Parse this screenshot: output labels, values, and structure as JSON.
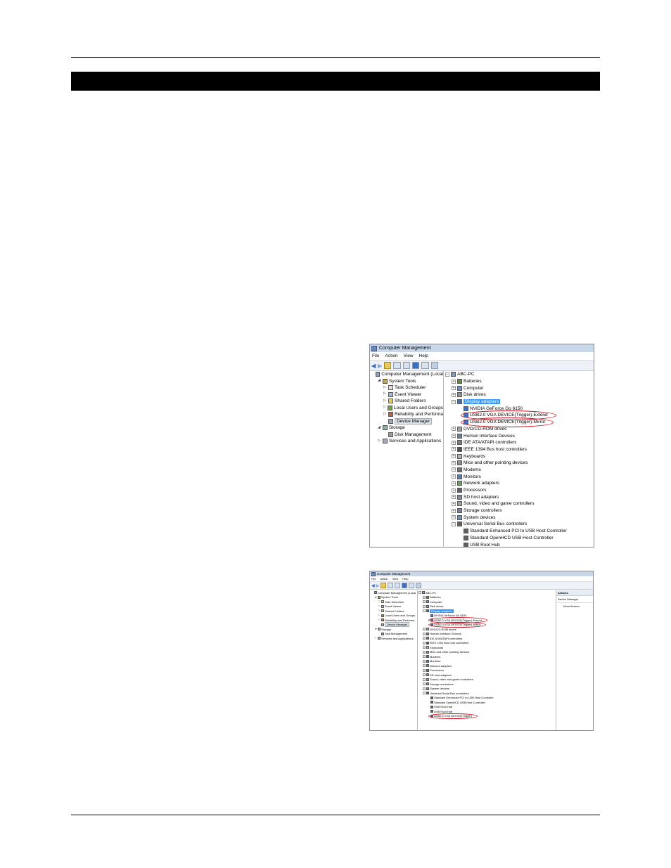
{
  "win1": {
    "title": "Computer Management",
    "menu": [
      "File",
      "Action",
      "View",
      "Help"
    ],
    "left_tree": [
      {
        "label": "Computer Management (Local",
        "level": 0,
        "exp": "none",
        "icon": "computer-management-icon",
        "color": "#8aa0c0"
      },
      {
        "label": "System Tools",
        "level": 1,
        "exp": "open",
        "icon": "tools-icon",
        "color": "#c9a04a"
      },
      {
        "label": "Task Scheduler",
        "level": 2,
        "exp": "closed",
        "icon": "clock-icon",
        "color": "#e8e0c8"
      },
      {
        "label": "Event Viewer",
        "level": 2,
        "exp": "closed",
        "icon": "event-viewer-icon",
        "color": "#9fb6d8"
      },
      {
        "label": "Shared Folders",
        "level": 2,
        "exp": "closed",
        "icon": "folder-icon",
        "color": "#e8c860"
      },
      {
        "label": "Local Users and Groups",
        "level": 2,
        "exp": "closed",
        "icon": "users-icon",
        "color": "#7a9a5a"
      },
      {
        "label": "Reliability and Performa",
        "level": 2,
        "exp": "closed",
        "icon": "gauge-icon",
        "color": "#c06040"
      },
      {
        "label": "Device Manager",
        "level": 2,
        "exp": "none",
        "icon": "device-manager-icon",
        "color": "#a0a8b8",
        "selected": true
      },
      {
        "label": "Storage",
        "level": 1,
        "exp": "open",
        "icon": "storage-icon",
        "color": "#8ab0a0"
      },
      {
        "label": "Disk Management",
        "level": 2,
        "exp": "none",
        "icon": "disk-icon",
        "color": "#9a9a9a"
      },
      {
        "label": "Services and Applications",
        "level": 1,
        "exp": "closed",
        "icon": "services-icon",
        "color": "#b0a0c0"
      }
    ],
    "right_tree": [
      {
        "label": "ABC-PC",
        "level": 0,
        "exp": "minus",
        "icon": "computer-icon",
        "color": "#8a9ab0"
      },
      {
        "label": "Batteries",
        "level": 1,
        "exp": "plus",
        "icon": "battery-icon",
        "color": "#6a8a4a"
      },
      {
        "label": "Computer",
        "level": 1,
        "exp": "plus",
        "icon": "computer-icon",
        "color": "#7090c0"
      },
      {
        "label": "Disk drives",
        "level": 1,
        "exp": "plus",
        "icon": "disk-drive-icon",
        "color": "#909090"
      },
      {
        "label": "Display adapters",
        "level": 1,
        "exp": "minus",
        "icon": "display-adapter-icon",
        "color": "#4070c0",
        "selected": true
      },
      {
        "label": "NVIDIA GeForce Go 6150",
        "level": 2,
        "exp": "none",
        "icon": "display-adapter-icon",
        "color": "#4070c0"
      },
      {
        "label": "USB2.0 VGA DEVICE(Trigger)-Extend",
        "level": 2,
        "exp": "none",
        "icon": "display-adapter-icon",
        "color": "#4070c0",
        "circled": true
      },
      {
        "label": "USB2.0 VGA DEVICE(Trigger)-Mirror",
        "level": 2,
        "exp": "none",
        "icon": "display-adapter-icon",
        "color": "#4070c0",
        "circled": true
      },
      {
        "label": "DVD/CD-ROM drives",
        "level": 1,
        "exp": "plus",
        "icon": "dvd-icon",
        "color": "#a0a0a0"
      },
      {
        "label": "Human Interface Devices",
        "level": 1,
        "exp": "plus",
        "icon": "hid-icon",
        "color": "#708090"
      },
      {
        "label": "IDE ATA/ATAPI controllers",
        "level": 1,
        "exp": "plus",
        "icon": "ide-icon",
        "color": "#808080"
      },
      {
        "label": "IEEE 1394 Bus host controllers",
        "level": 1,
        "exp": "plus",
        "icon": "firewire-icon",
        "color": "#505050"
      },
      {
        "label": "Keyboards",
        "level": 1,
        "exp": "plus",
        "icon": "keyboard-icon",
        "color": "#b0b0b0"
      },
      {
        "label": "Mice and other pointing devices",
        "level": 1,
        "exp": "plus",
        "icon": "mouse-icon",
        "color": "#909090"
      },
      {
        "label": "Modems",
        "level": 1,
        "exp": "plus",
        "icon": "modem-icon",
        "color": "#707070"
      },
      {
        "label": "Monitors",
        "level": 1,
        "exp": "plus",
        "icon": "monitor-icon",
        "color": "#5080b0"
      },
      {
        "label": "Network adapters",
        "level": 1,
        "exp": "plus",
        "icon": "network-icon",
        "color": "#60a060"
      },
      {
        "label": "Processors",
        "level": 1,
        "exp": "plus",
        "icon": "processor-icon",
        "color": "#606060"
      },
      {
        "label": "SD host adapters",
        "level": 1,
        "exp": "plus",
        "icon": "sd-card-icon",
        "color": "#8090a0"
      },
      {
        "label": "Sound, video and game controllers",
        "level": 1,
        "exp": "plus",
        "icon": "speaker-icon",
        "color": "#a0a0a0"
      },
      {
        "label": "Storage controllers",
        "level": 1,
        "exp": "plus",
        "icon": "storage-controller-icon",
        "color": "#8080a0"
      },
      {
        "label": "System devices",
        "level": 1,
        "exp": "plus",
        "icon": "system-device-icon",
        "color": "#7090b0"
      },
      {
        "label": "Universal Serial Bus controllers",
        "level": 1,
        "exp": "minus",
        "icon": "usb-icon",
        "color": "#606060"
      },
      {
        "label": "Standard Enhanced PCI to USB Host Controller",
        "level": 2,
        "exp": "none",
        "icon": "usb-icon",
        "color": "#606060"
      },
      {
        "label": "Standard OpenHCD USB Host Controller",
        "level": 2,
        "exp": "none",
        "icon": "usb-icon",
        "color": "#606060"
      },
      {
        "label": "USB Root Hub",
        "level": 2,
        "exp": "none",
        "icon": "usb-icon",
        "color": "#606060"
      }
    ]
  },
  "win2": {
    "title": "Computer Management",
    "menu": [
      "File",
      "Action",
      "View",
      "Help"
    ],
    "actions_header": "Actions",
    "actions_section": "Device Manager",
    "actions_more": "More Actions",
    "left_tree": [
      {
        "label": "Computer Management (Local",
        "level": 0,
        "exp": "none",
        "icon": "computer-management-icon",
        "color": "#8aa0c0"
      },
      {
        "label": "System Tools",
        "level": 1,
        "exp": "open",
        "icon": "tools-icon",
        "color": "#c9a04a"
      },
      {
        "label": "Task Scheduler",
        "level": 2,
        "exp": "closed",
        "icon": "clock-icon",
        "color": "#e8e0c8"
      },
      {
        "label": "Event Viewer",
        "level": 2,
        "exp": "closed",
        "icon": "event-viewer-icon",
        "color": "#9fb6d8"
      },
      {
        "label": "Shared Folders",
        "level": 2,
        "exp": "closed",
        "icon": "folder-icon",
        "color": "#e8c860"
      },
      {
        "label": "Local Users and Groups",
        "level": 2,
        "exp": "closed",
        "icon": "users-icon",
        "color": "#7a9a5a"
      },
      {
        "label": "Reliability and Performa",
        "level": 2,
        "exp": "closed",
        "icon": "gauge-icon",
        "color": "#c06040"
      },
      {
        "label": "Device Manager",
        "level": 2,
        "exp": "none",
        "icon": "device-manager-icon",
        "color": "#a0a8b8",
        "selected": true
      },
      {
        "label": "Storage",
        "level": 1,
        "exp": "open",
        "icon": "storage-icon",
        "color": "#8ab0a0"
      },
      {
        "label": "Disk Management",
        "level": 2,
        "exp": "none",
        "icon": "disk-icon",
        "color": "#9a9a9a"
      },
      {
        "label": "Services and Applications",
        "level": 1,
        "exp": "closed",
        "icon": "services-icon",
        "color": "#b0a0c0"
      }
    ],
    "right_tree": [
      {
        "label": "ABC-PC",
        "level": 0,
        "exp": "minus",
        "icon": "computer-icon",
        "color": "#8a9ab0"
      },
      {
        "label": "Batteries",
        "level": 1,
        "exp": "plus",
        "icon": "battery-icon",
        "color": "#6a8a4a"
      },
      {
        "label": "Computer",
        "level": 1,
        "exp": "plus",
        "icon": "computer-icon",
        "color": "#7090c0"
      },
      {
        "label": "Disk drives",
        "level": 1,
        "exp": "plus",
        "icon": "disk-drive-icon",
        "color": "#909090"
      },
      {
        "label": "Display adapters",
        "level": 1,
        "exp": "minus",
        "icon": "display-adapter-icon",
        "color": "#4070c0",
        "selected": true
      },
      {
        "label": "NVIDIA GeForce Go 6150",
        "level": 2,
        "exp": "none",
        "icon": "display-adapter-icon",
        "color": "#4070c0"
      },
      {
        "label": "USB2.0 VGA DEVICE(Trigger)-Extend",
        "level": 2,
        "exp": "none",
        "icon": "display-adapter-icon",
        "color": "#4070c0",
        "circled": true
      },
      {
        "label": "USB2.0 VGA DEVICE(Trigger)-Mirror",
        "level": 2,
        "exp": "none",
        "icon": "display-adapter-icon",
        "color": "#4070c0",
        "circled": true
      },
      {
        "label": "DVD/CD-ROM drives",
        "level": 1,
        "exp": "plus",
        "icon": "dvd-icon",
        "color": "#a0a0a0"
      },
      {
        "label": "Human Interface Devices",
        "level": 1,
        "exp": "plus",
        "icon": "hid-icon",
        "color": "#708090"
      },
      {
        "label": "IDE ATA/ATAPI controllers",
        "level": 1,
        "exp": "plus",
        "icon": "ide-icon",
        "color": "#808080"
      },
      {
        "label": "IEEE 1394 Bus host controllers",
        "level": 1,
        "exp": "plus",
        "icon": "firewire-icon",
        "color": "#505050"
      },
      {
        "label": "Keyboards",
        "level": 1,
        "exp": "plus",
        "icon": "keyboard-icon",
        "color": "#b0b0b0"
      },
      {
        "label": "Mice and other pointing devices",
        "level": 1,
        "exp": "plus",
        "icon": "mouse-icon",
        "color": "#909090"
      },
      {
        "label": "Modems",
        "level": 1,
        "exp": "plus",
        "icon": "modem-icon",
        "color": "#707070"
      },
      {
        "label": "Monitors",
        "level": 1,
        "exp": "plus",
        "icon": "monitor-icon",
        "color": "#5080b0"
      },
      {
        "label": "Network adapters",
        "level": 1,
        "exp": "plus",
        "icon": "network-icon",
        "color": "#60a060"
      },
      {
        "label": "Processors",
        "level": 1,
        "exp": "plus",
        "icon": "processor-icon",
        "color": "#606060"
      },
      {
        "label": "SD host adapters",
        "level": 1,
        "exp": "plus",
        "icon": "sd-card-icon",
        "color": "#8090a0"
      },
      {
        "label": "Sound, video and game controllers",
        "level": 1,
        "exp": "plus",
        "icon": "speaker-icon",
        "color": "#a0a0a0"
      },
      {
        "label": "Storage controllers",
        "level": 1,
        "exp": "plus",
        "icon": "storage-controller-icon",
        "color": "#8080a0"
      },
      {
        "label": "System devices",
        "level": 1,
        "exp": "plus",
        "icon": "system-device-icon",
        "color": "#7090b0"
      },
      {
        "label": "Universal Serial Bus controllers",
        "level": 1,
        "exp": "minus",
        "icon": "usb-icon",
        "color": "#606060"
      },
      {
        "label": "Standard Enhanced PCI to USB Host Controller",
        "level": 2,
        "exp": "none",
        "icon": "usb-icon",
        "color": "#606060"
      },
      {
        "label": "Standard OpenHCD USB Host Controller",
        "level": 2,
        "exp": "none",
        "icon": "usb-icon",
        "color": "#606060"
      },
      {
        "label": "USB Root Hub",
        "level": 2,
        "exp": "none",
        "icon": "usb-icon",
        "color": "#606060"
      },
      {
        "label": "USB Root Hub",
        "level": 2,
        "exp": "none",
        "icon": "usb-icon",
        "color": "#606060"
      },
      {
        "label": "USB2.0 VGA DEVICE(Trigger)",
        "level": 2,
        "exp": "none",
        "icon": "usb-icon",
        "color": "#606060",
        "circled": true
      }
    ]
  }
}
